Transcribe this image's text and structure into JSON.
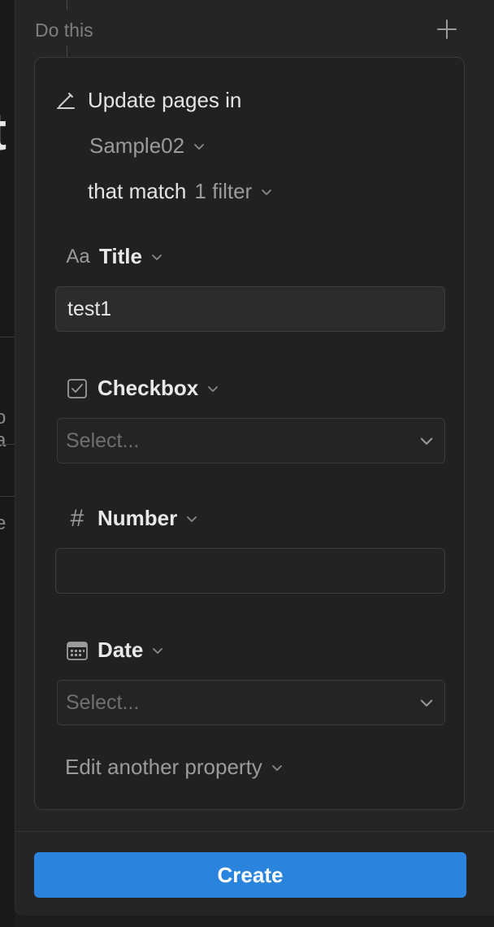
{
  "section": {
    "label": "Do this"
  },
  "action": {
    "title": "Update pages in"
  },
  "database": {
    "name": "Sample02"
  },
  "filter": {
    "lead": "that match",
    "count": "1 filter"
  },
  "properties": {
    "title": {
      "type_icon": "Aa",
      "name": "Title",
      "value": "test1"
    },
    "checkbox": {
      "name": "Checkbox",
      "placeholder": "Select..."
    },
    "number": {
      "type_icon": "#",
      "name": "Number",
      "value": ""
    },
    "date": {
      "name": "Date",
      "placeholder": "Select..."
    }
  },
  "edit_another": {
    "label": "Edit another property"
  },
  "create_button": {
    "label": "Create"
  },
  "colors": {
    "accent": "#2a83dc",
    "panel": "#252525",
    "card": "#212121"
  },
  "icons": {
    "add": "plus-icon",
    "action": "pencil-icon",
    "checkbox": "checkbox-icon",
    "number": "hash-icon",
    "date": "calendar-icon",
    "dropdown": "chevron-down-icon"
  }
}
